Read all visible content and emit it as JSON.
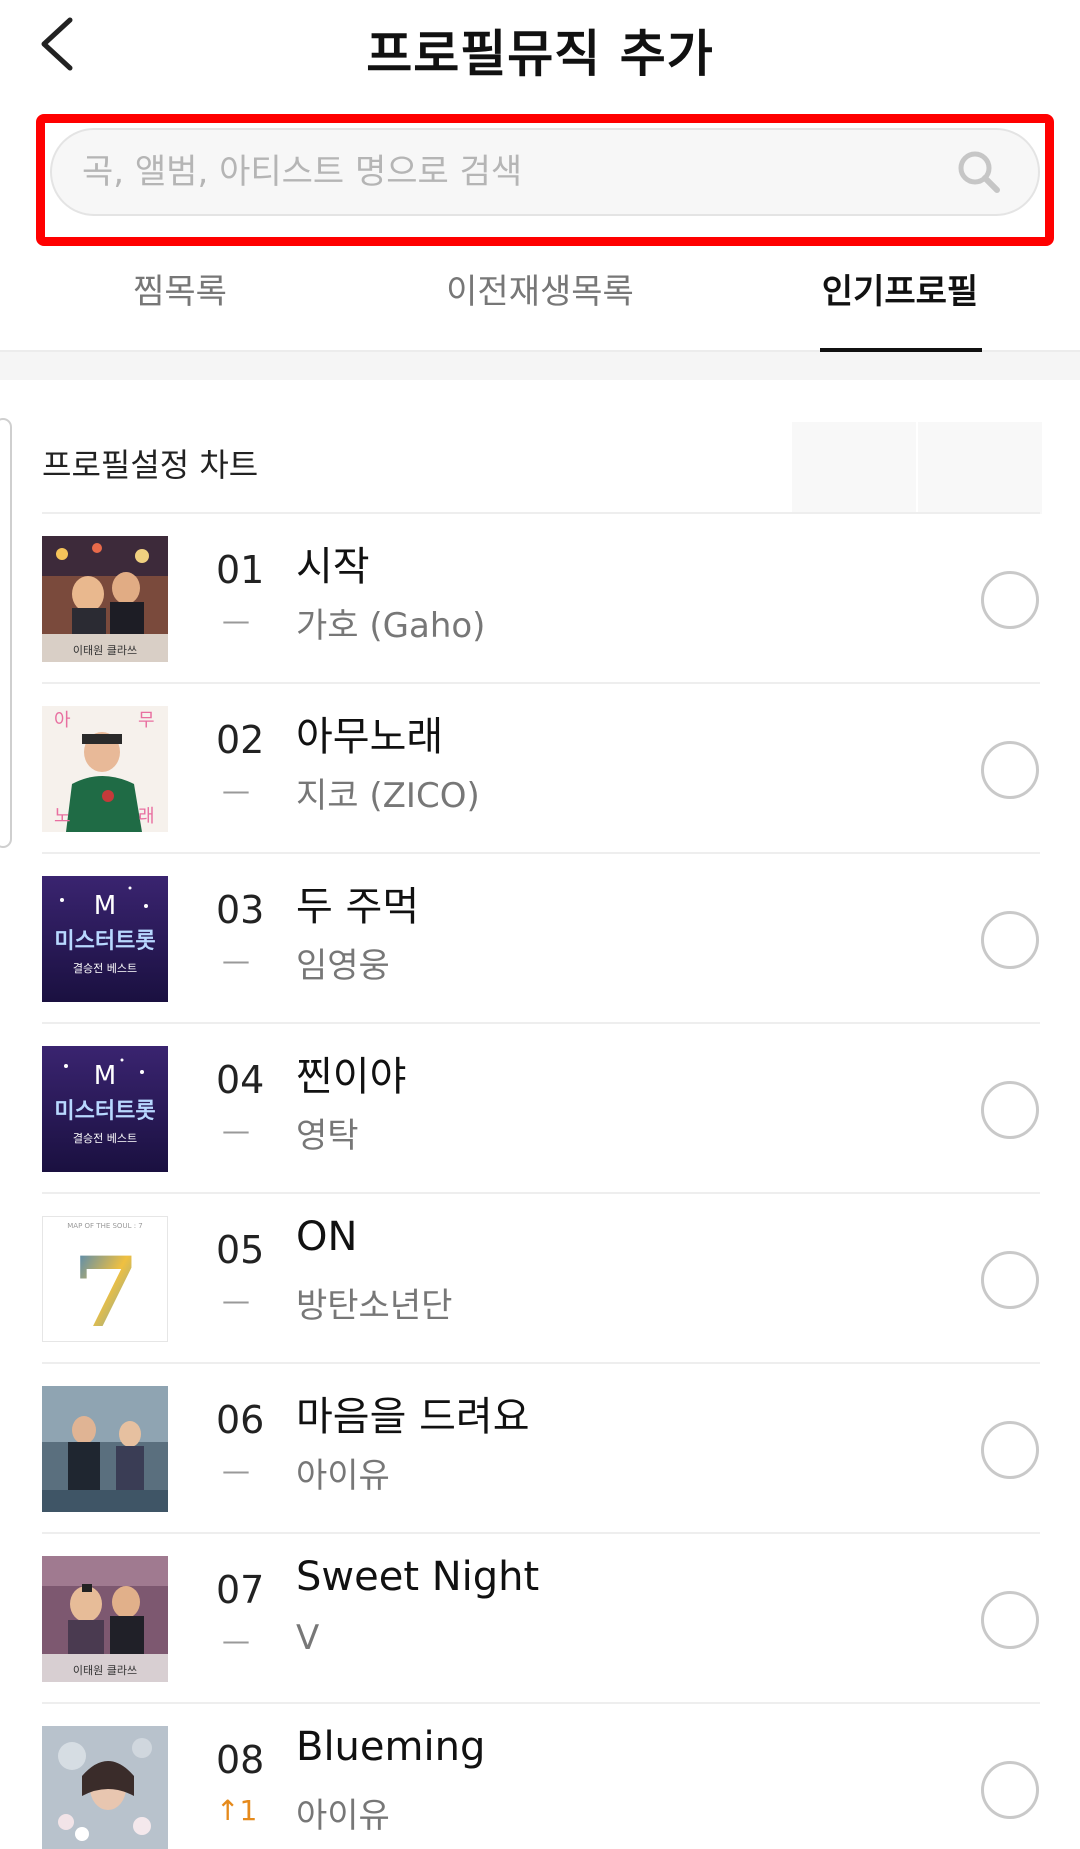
{
  "header": {
    "title": "프로필뮤직 추가",
    "back_icon": "chevron-left-icon"
  },
  "search": {
    "placeholder": "곡, 앨범, 아티스트 명으로 검색",
    "value": "",
    "icon": "search-icon",
    "highlight_color": "#ff0000"
  },
  "tabs": [
    {
      "label": "찜목록",
      "active": false
    },
    {
      "label": "이전재생목록",
      "active": false
    },
    {
      "label": "인기프로필",
      "active": true
    }
  ],
  "chart": {
    "title": "프로필설정 차트",
    "rows": [
      {
        "rank": "01",
        "change": "—",
        "change_type": "same",
        "title": "시작",
        "artist": "가호 (Gaho)"
      },
      {
        "rank": "02",
        "change": "—",
        "change_type": "same",
        "title": "아무노래",
        "artist": "지코 (ZICO)"
      },
      {
        "rank": "03",
        "change": "—",
        "change_type": "same",
        "title": "두 주먹",
        "artist": "임영웅"
      },
      {
        "rank": "04",
        "change": "—",
        "change_type": "same",
        "title": "찐이야",
        "artist": "영탁"
      },
      {
        "rank": "05",
        "change": "—",
        "change_type": "same",
        "title": "ON",
        "artist": "방탄소년단"
      },
      {
        "rank": "06",
        "change": "—",
        "change_type": "same",
        "title": "마음을 드려요",
        "artist": "아이유"
      },
      {
        "rank": "07",
        "change": "—",
        "change_type": "same",
        "title": "Sweet Night",
        "artist": "V"
      },
      {
        "rank": "08",
        "change": "↑1",
        "change_type": "up",
        "title": "Blueming",
        "artist": "아이유"
      }
    ]
  },
  "colors": {
    "accent_up": "#e58a1c",
    "active_tab": "#111111",
    "inactive_tab": "#777777"
  },
  "album_art_text": {
    "itaewon": "이태원 클라쓰",
    "anything": [
      "아",
      "무",
      "노",
      "래"
    ],
    "mister_trot_m": "M",
    "mister_trot": "미스터트롯",
    "mister_trot_sub": "결승전 베스트",
    "bts_seven": "7",
    "bts_caption": "MAP OF THE SOUL : 7"
  }
}
